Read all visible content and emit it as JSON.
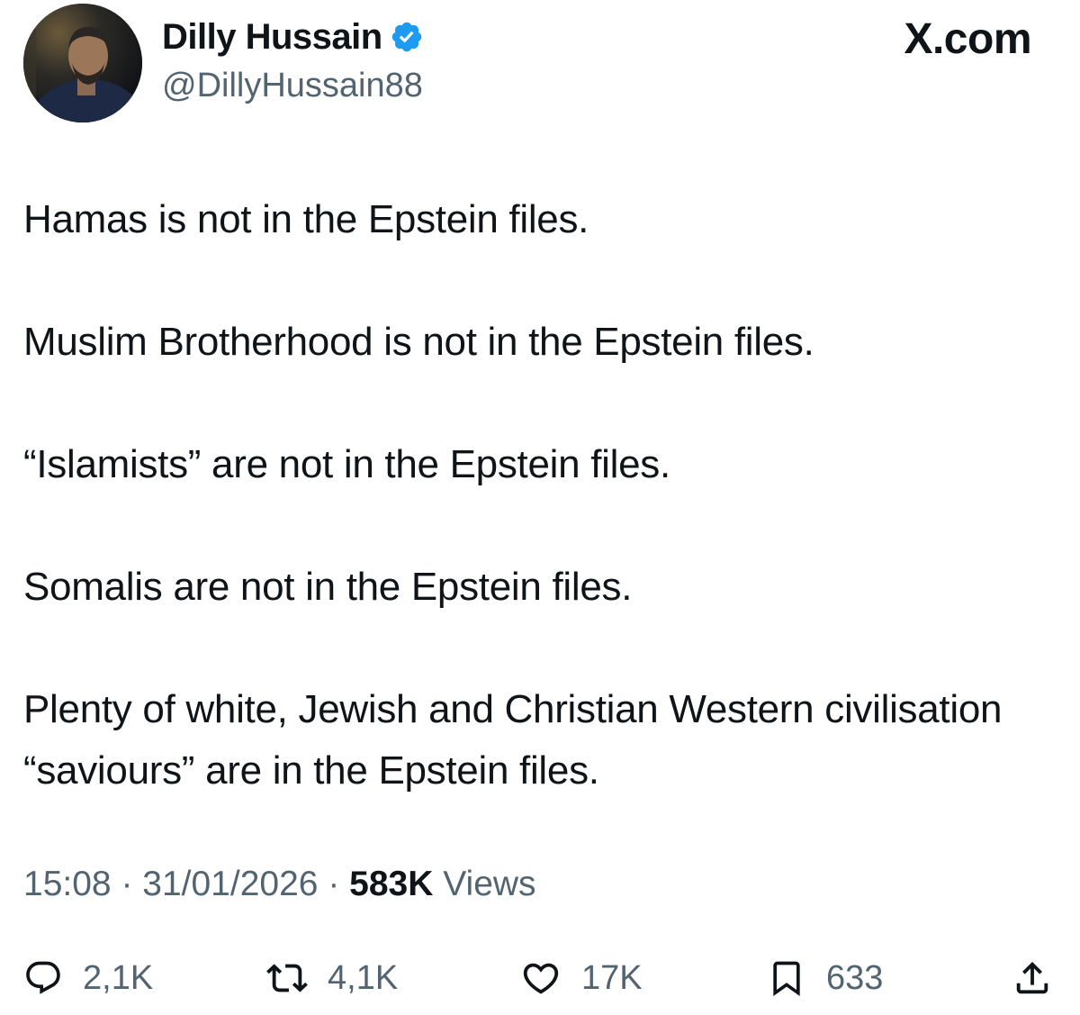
{
  "author": {
    "display_name": "Dilly Hussain",
    "handle": "@DillyHussain88",
    "verified": true,
    "avatar_icon": "profile-photo"
  },
  "brand": {
    "label": "X.com"
  },
  "tweet": {
    "paragraphs": [
      "Hamas is not in the Epstein files.",
      "Muslim Brotherhood is not in the Epstein files.",
      "“Islamists” are not in the Epstein files.",
      "Somalis are not in the Epstein files.",
      "Plenty of white, Jewish and Christian Western civilisation “saviours” are in the Epstein files."
    ]
  },
  "meta": {
    "time": "15:08",
    "separator": " · ",
    "date": "31/01/2026",
    "views_count": "583K",
    "views_label": " Views"
  },
  "actions": {
    "reply": {
      "icon": "reply-icon",
      "count": "2,1K"
    },
    "repost": {
      "icon": "repost-icon",
      "count": "4,1K"
    },
    "like": {
      "icon": "heart-icon",
      "count": "17K"
    },
    "bookmark": {
      "icon": "bookmark-icon",
      "count": "633"
    },
    "share": {
      "icon": "share-icon"
    }
  },
  "colors": {
    "text_primary": "#0f1419",
    "text_secondary": "#536471",
    "verified_blue": "#1d9bf0"
  }
}
